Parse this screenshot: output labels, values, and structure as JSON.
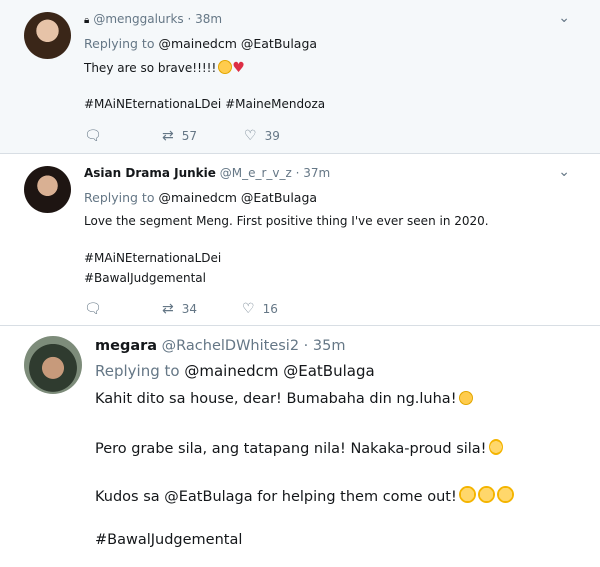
{
  "tweets": [
    {
      "name": "",
      "handle": "@menggalurks",
      "time": "38m",
      "replying_label": "Replying to",
      "replying_to": [
        "@mainedcm",
        "@EatBulaga"
      ],
      "lines": [
        "They are so brave!!!!!",
        "#MAiNEternationaLDei #MaineMendoza"
      ],
      "retweets": "57",
      "likes": "39"
    },
    {
      "name": "Asian Drama Junkie",
      "handle": "@M_e_r_v_z",
      "time": "37m",
      "replying_label": "Replying to",
      "replying_to": [
        "@mainedcm",
        "@EatBulaga"
      ],
      "lines": [
        "Love the segment Meng. First positive thing I've ever seen in 2020.",
        "#MAiNEternationaLDei",
        "#BawalJudgemental"
      ],
      "retweets": "34",
      "likes": "16"
    },
    {
      "name": "megara",
      "handle": "@RachelDWhitesi2",
      "time": "35m",
      "replying_label": "Replying to",
      "replying_to": [
        "@mainedcm",
        "@EatBulaga"
      ],
      "lines": [
        "Kahit dito sa house, dear! Bumabaha din ng.luha!",
        "Pero grabe sila, ang tatapang nila! Nakaka-proud sila!",
        "Kudos sa @EatBulaga for helping them come out!",
        "#BawalJudgemental"
      ]
    }
  ],
  "icons": {
    "reply": "reply-icon",
    "retweet": "retweet-icon",
    "like": "like-icon",
    "menu": "chevron-down-icon"
  }
}
